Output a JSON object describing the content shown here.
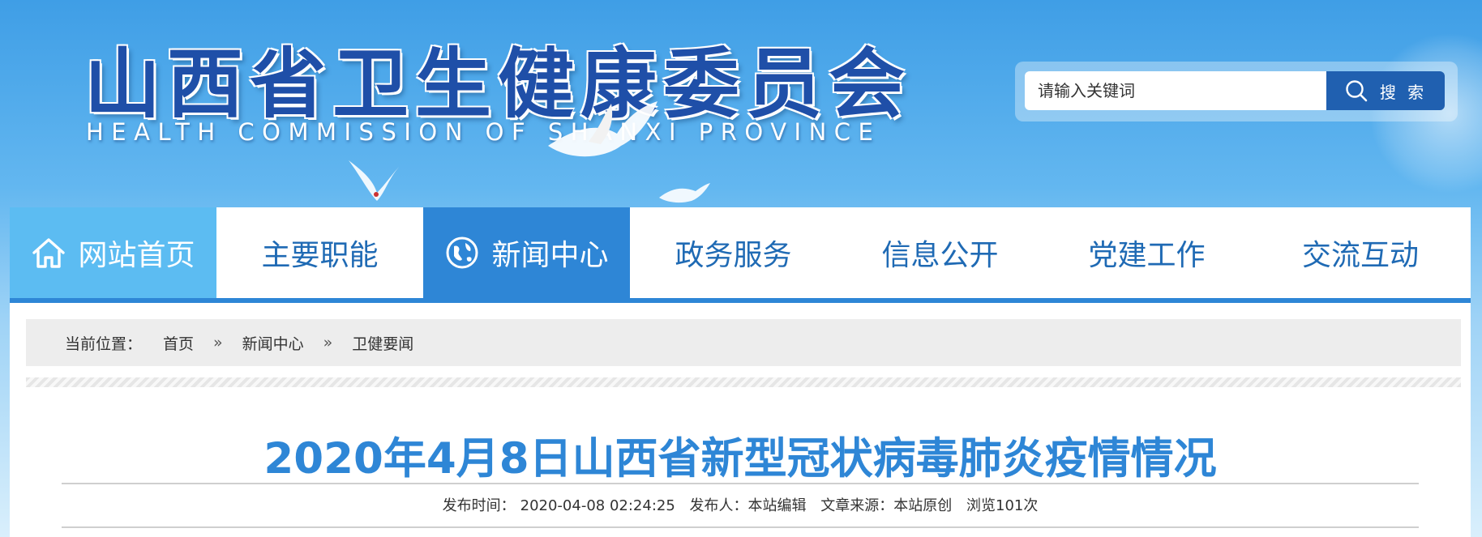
{
  "header": {
    "site_title": "山西省卫生健康委员会",
    "site_subtitle": "HEALTH COMMISSION OF SHANXI PROVINCE"
  },
  "search": {
    "placeholder": "请输入关键词",
    "button_label": "搜 索"
  },
  "nav": {
    "items": [
      {
        "label": "网站首页"
      },
      {
        "label": "主要职能"
      },
      {
        "label": "新闻中心"
      },
      {
        "label": "政务服务"
      },
      {
        "label": "信息公开"
      },
      {
        "label": "党建工作"
      },
      {
        "label": "交流互动"
      }
    ]
  },
  "breadcrumb": {
    "label": "当前位置：",
    "separator": "»",
    "items": [
      "首页",
      "新闻中心",
      "卫健要闻"
    ]
  },
  "article": {
    "title": "2020年4月8日山西省新型冠状病毒肺炎疫情情况",
    "meta": {
      "time_label": "发布时间：",
      "time_value": "2020-04-08 02:24:25",
      "publisher_label": "发布人：",
      "publisher_value": "本站编辑",
      "source_label": "文章来源：",
      "source_value": "本站原创",
      "views": "浏览101次"
    }
  },
  "colors": {
    "brand_blue": "#2e86d6",
    "title_blue": "#1f4fa8",
    "nav_home_bg": "#5cbcf2"
  }
}
